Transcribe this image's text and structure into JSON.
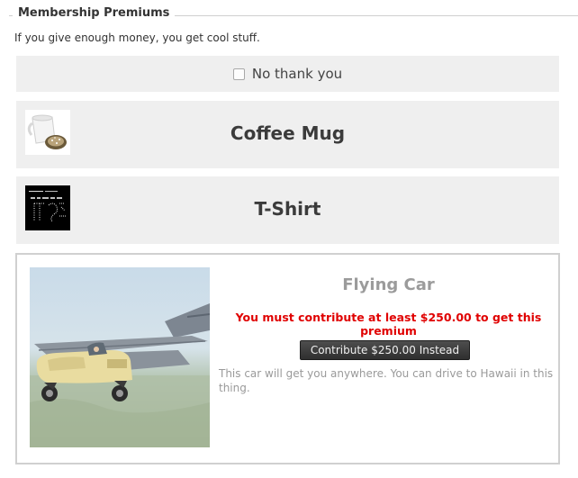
{
  "fieldset": {
    "legend": "Membership Premiums",
    "intro": "If you give enough money, you get cool stuff."
  },
  "no_thanks": {
    "label": "No thank you",
    "checked": false
  },
  "premiums": [
    {
      "name": "Coffee Mug",
      "thumbnail": "coffee-mug-image"
    },
    {
      "name": "T-Shirt",
      "thumbnail": "t-shirt-image"
    }
  ],
  "featured": {
    "name": "Flying Car",
    "image": "flying-car-image",
    "warning": "You must contribute at least $250.00 to get this premium",
    "button_label": "Contribute $250.00 Instead",
    "description": "This car will get you anywhere. You can drive to Hawaii in this thing."
  },
  "colors": {
    "panel_bg": "#efefef",
    "warning": "#e00000",
    "muted_text": "#9a9a9a",
    "button_bg": "#3a3a3a"
  }
}
